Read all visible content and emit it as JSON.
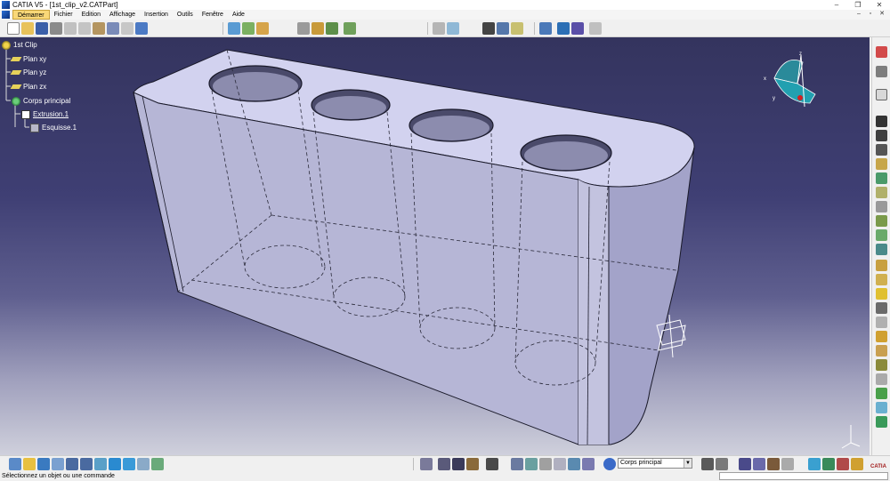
{
  "window": {
    "title": "CATIA V5 - [1st_clip_v2.CATPart]",
    "controls": [
      "–",
      "❐",
      "✕"
    ]
  },
  "menu": {
    "items": [
      "Démarrer",
      "Fichier",
      "Edition",
      "Affichage",
      "Insertion",
      "Outils",
      "Fenêtre",
      "Aide"
    ],
    "mdi_controls": [
      "–",
      "▫",
      "✕"
    ]
  },
  "tree": {
    "root": "1st Clip",
    "plane_xy": "Plan xy",
    "plane_yz": "Plan yz",
    "plane_zx": "Plan zx",
    "body": "Corps principal",
    "extrusion": "Extrusion.1",
    "sketch": "Esquisse.1"
  },
  "compass": {
    "x_label": "x",
    "y_label": "y",
    "z_label": "z"
  },
  "bottom_toolbar": {
    "current_body": "Corps principal",
    "logo": "CATIA"
  },
  "status": {
    "message": "Sélectionnez un objet ou une commande"
  },
  "colors": {
    "viewport_top": "#34345e",
    "viewport_bottom": "#cfd0dc",
    "part_face_top": "#d0d0ee",
    "part_face_front": "#b4b4d4",
    "part_face_side": "#9d9dc4",
    "accent_menu": "#f9d878"
  }
}
